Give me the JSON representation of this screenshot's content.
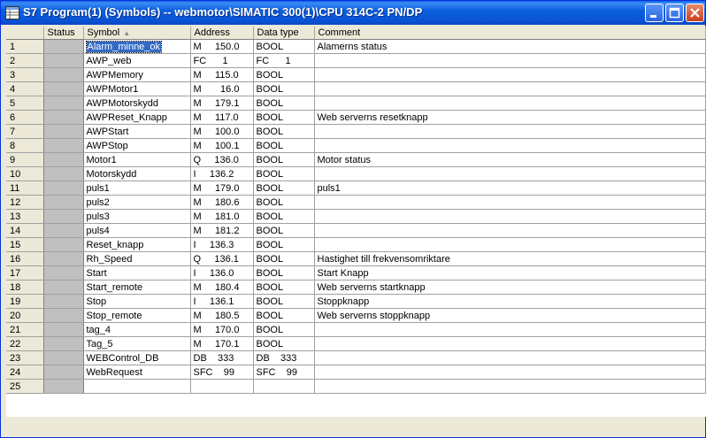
{
  "window": {
    "title": "S7 Program(1) (Symbols) -- webmotor\\SIMATIC 300(1)\\CPU 314C-2 PN/DP"
  },
  "columns": {
    "status": "Status",
    "symbol": "Symbol",
    "address": "Address",
    "datatype": "Data type",
    "comment": "Comment"
  },
  "rows": [
    {
      "n": "1",
      "symbol": "Alarm_minne_ok",
      "address": "M     150.0",
      "datatype": "BOOL",
      "comment": "Alamerns status"
    },
    {
      "n": "2",
      "symbol": "AWP_web",
      "address": "FC      1",
      "datatype": "FC      1",
      "comment": ""
    },
    {
      "n": "3",
      "symbol": "AWPMemory",
      "address": "M     115.0",
      "datatype": "BOOL",
      "comment": ""
    },
    {
      "n": "4",
      "symbol": "AWPMotor1",
      "address": "M       16.0",
      "datatype": "BOOL",
      "comment": ""
    },
    {
      "n": "5",
      "symbol": "AWPMotorskydd",
      "address": "M     179.1",
      "datatype": "BOOL",
      "comment": ""
    },
    {
      "n": "6",
      "symbol": "AWPReset_Knapp",
      "address": "M     117.0",
      "datatype": "BOOL",
      "comment": "Web serverns resetknapp"
    },
    {
      "n": "7",
      "symbol": "AWPStart",
      "address": "M     100.0",
      "datatype": "BOOL",
      "comment": ""
    },
    {
      "n": "8",
      "symbol": "AWPStop",
      "address": "M     100.1",
      "datatype": "BOOL",
      "comment": ""
    },
    {
      "n": "9",
      "symbol": "Motor1",
      "address": "Q     136.0",
      "datatype": "BOOL",
      "comment": "Motor status"
    },
    {
      "n": "10",
      "symbol": "Motorskydd",
      "address": "I     136.2",
      "datatype": "BOOL",
      "comment": ""
    },
    {
      "n": "11",
      "symbol": "puls1",
      "address": "M     179.0",
      "datatype": "BOOL",
      "comment": "puls1"
    },
    {
      "n": "12",
      "symbol": "puls2",
      "address": "M     180.6",
      "datatype": "BOOL",
      "comment": ""
    },
    {
      "n": "13",
      "symbol": "puls3",
      "address": "M     181.0",
      "datatype": "BOOL",
      "comment": ""
    },
    {
      "n": "14",
      "symbol": "puls4",
      "address": "M     181.2",
      "datatype": "BOOL",
      "comment": ""
    },
    {
      "n": "15",
      "symbol": "Reset_knapp",
      "address": "I     136.3",
      "datatype": "BOOL",
      "comment": ""
    },
    {
      "n": "16",
      "symbol": "Rh_Speed",
      "address": "Q     136.1",
      "datatype": "BOOL",
      "comment": "Hastighet till frekvensomriktare"
    },
    {
      "n": "17",
      "symbol": "Start",
      "address": "I     136.0",
      "datatype": "BOOL",
      "comment": "Start Knapp"
    },
    {
      "n": "18",
      "symbol": "Start_remote",
      "address": "M     180.4",
      "datatype": "BOOL",
      "comment": "Web serverns startknapp"
    },
    {
      "n": "19",
      "symbol": "Stop",
      "address": "I     136.1",
      "datatype": "BOOL",
      "comment": "Stoppknapp"
    },
    {
      "n": "20",
      "symbol": "Stop_remote",
      "address": "M     180.5",
      "datatype": "BOOL",
      "comment": "Web serverns stoppknapp"
    },
    {
      "n": "21",
      "symbol": "tag_4",
      "address": "M     170.0",
      "datatype": "BOOL",
      "comment": ""
    },
    {
      "n": "22",
      "symbol": "Tag_5",
      "address": "M     170.1",
      "datatype": "BOOL",
      "comment": ""
    },
    {
      "n": "23",
      "symbol": "WEBControl_DB",
      "address": "DB    333",
      "datatype": "DB    333",
      "comment": ""
    },
    {
      "n": "24",
      "symbol": "WebRequest",
      "address": "SFC    99",
      "datatype": "SFC    99",
      "comment": ""
    },
    {
      "n": "25",
      "symbol": "",
      "address": "",
      "datatype": "",
      "comment": ""
    }
  ],
  "colors": {
    "titlebar": "#0a5ee8",
    "selection": "#316ac5",
    "status_cell": "#c0c0c0"
  }
}
